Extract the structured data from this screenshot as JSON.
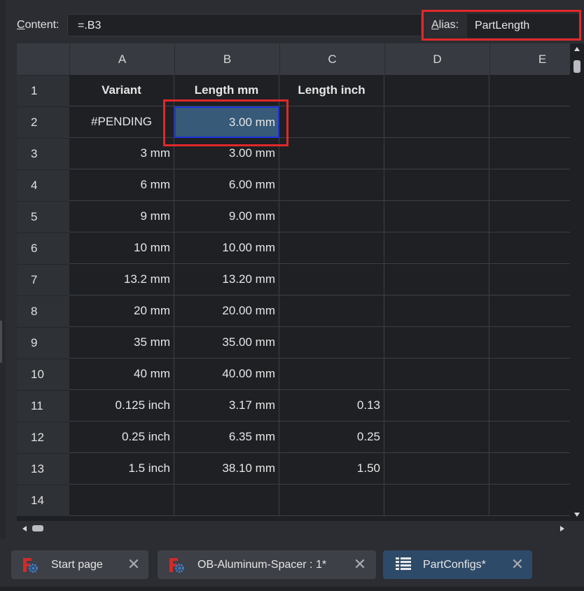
{
  "content_bar": {
    "content_label": "Content:",
    "content_value": "=.B3",
    "alias_label": "Alias:",
    "alias_value": "PartLength"
  },
  "columns": [
    "A",
    "B",
    "C",
    "D",
    "E"
  ],
  "rows": [
    {
      "num": "1",
      "a": "Variant",
      "b": "Length mm",
      "c": "Length inch"
    },
    {
      "num": "2",
      "a": "#PENDING",
      "b": "3.00 mm",
      "c": ""
    },
    {
      "num": "3",
      "a": "3 mm",
      "b": "3.00 mm",
      "c": ""
    },
    {
      "num": "4",
      "a": "6 mm",
      "b": "6.00 mm",
      "c": ""
    },
    {
      "num": "5",
      "a": "9 mm",
      "b": "9.00 mm",
      "c": ""
    },
    {
      "num": "6",
      "a": "10 mm",
      "b": "10.00 mm",
      "c": ""
    },
    {
      "num": "7",
      "a": "13.2 mm",
      "b": "13.20 mm",
      "c": ""
    },
    {
      "num": "8",
      "a": "20 mm",
      "b": "20.00 mm",
      "c": ""
    },
    {
      "num": "9",
      "a": "35 mm",
      "b": "35.00 mm",
      "c": ""
    },
    {
      "num": "10",
      "a": "40 mm",
      "b": "40.00 mm",
      "c": ""
    },
    {
      "num": "11",
      "a": "0.125 inch",
      "b": "3.17 mm",
      "c": "0.13"
    },
    {
      "num": "12",
      "a": "0.25 inch",
      "b": "6.35 mm",
      "c": "0.25"
    },
    {
      "num": "13",
      "a": "1.5 inch",
      "b": "38.10 mm",
      "c": "1.50"
    },
    {
      "num": "14",
      "a": "",
      "b": "",
      "c": ""
    }
  ],
  "tabs": [
    {
      "label": "Start page",
      "icon": "freecad-gear-icon",
      "active": false
    },
    {
      "label": "OB-Aluminum-Spacer : 1*",
      "icon": "freecad-gear-icon",
      "active": false
    },
    {
      "label": "PartConfigs*",
      "icon": "spreadsheet-icon",
      "active": true
    }
  ],
  "colors": {
    "highlight_red": "#e0282a",
    "selection_border": "#1d35d8",
    "selection_fill": "#375a78",
    "active_tab": "#2d4a68"
  }
}
